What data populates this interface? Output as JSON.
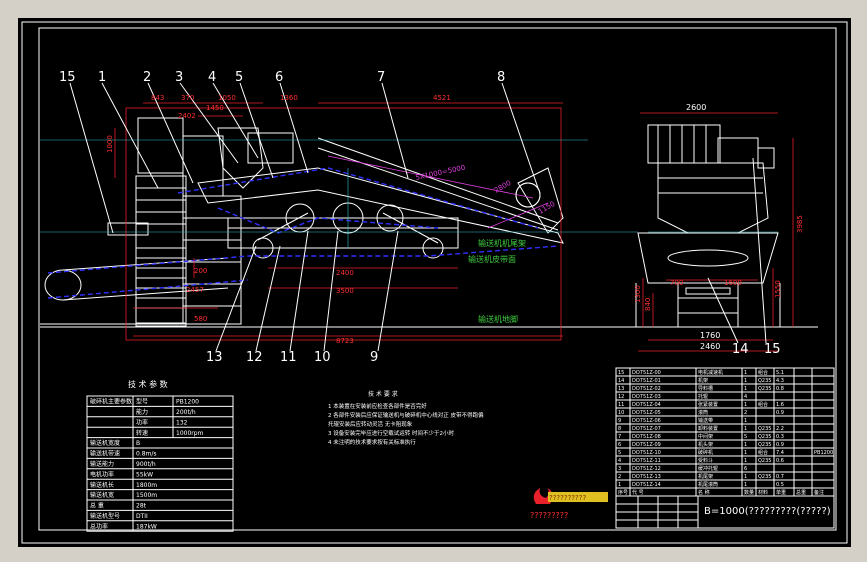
{
  "front_view": {
    "callouts": [
      "15",
      "1",
      "2",
      "3",
      "4",
      "5",
      "6",
      "7",
      "8",
      "13",
      "12",
      "11",
      "10",
      "9"
    ],
    "dimensions": {
      "d843": "843",
      "d370": "370",
      "d2402": "2402",
      "d1450": "1450",
      "d1050": "1050",
      "d1360": "1360",
      "d4521": "4521",
      "d1000": "1000",
      "d5x1000": "5X1000=5000",
      "d2800": "2800",
      "d1150": "1150",
      "d2400": "2400",
      "d3500": "3500",
      "d2457": "2457",
      "d200": "200",
      "d8723": "8723",
      "d580": "580"
    },
    "labels": {
      "tail_frame": "输送机机尾架",
      "belt_face": "输送机皮带面",
      "foundation": "输送机地脚"
    }
  },
  "side_view": {
    "callouts": [
      "14",
      "15"
    ],
    "dimensions": {
      "width": "2600",
      "right_h1": "3985",
      "right_h2": "1550",
      "left_h": "1300",
      "left_h2": "840",
      "d700": "700",
      "d1600": "1600",
      "bottom1": "1760",
      "bottom2": "2460"
    }
  },
  "tech_params": {
    "title": "技 术 参 数",
    "rows": [
      [
        "破碎机主要参数",
        "型号",
        "PB1200"
      ],
      [
        "",
        "能力",
        "200t/h"
      ],
      [
        "",
        "功率",
        "132"
      ],
      [
        "",
        "转速",
        "1000rpm"
      ],
      [
        "输送机宽度",
        "B",
        ""
      ],
      [
        "输送机带速",
        "0.8m/s",
        ""
      ],
      [
        "输送能力",
        "900t/h",
        ""
      ],
      [
        "电机功率",
        "55kW",
        ""
      ],
      [
        "输送机长",
        "1800m",
        ""
      ],
      [
        "输送机宽",
        "1500m",
        ""
      ],
      [
        "总 重",
        "28t",
        ""
      ],
      [
        "输送机型号",
        "DTII",
        ""
      ],
      [
        "总功率",
        "187kW",
        ""
      ]
    ]
  },
  "notes": {
    "title": "技 术 要 求",
    "lines": [
      "1 本装置在安装前应检查各部件是否完好",
      "2 各部件安装后应保证输送机与破碎机中心线对正 皮带不得跑偏",
      "  托辊安装后应转动灵活 无卡阻现象",
      "3 设备安装完毕应进行空载试运转 时间不少于2小时",
      "4 未注明的技术要求按有关标准执行"
    ]
  },
  "parts_list": {
    "headers": [
      "序号",
      "代 号",
      "名 称",
      "数量",
      "材料",
      "单重",
      "总重",
      "备注"
    ],
    "rows": [
      [
        "15",
        "DO751Z-00",
        "电机减速机",
        "1",
        "组合",
        "5.1",
        "",
        ""
      ],
      [
        "14",
        "DO751Z-01",
        "机架",
        "1",
        "Q235",
        "4.3",
        "",
        ""
      ],
      [
        "13",
        "DO751Z-02",
        "导料槽",
        "1",
        "Q235",
        "0.8",
        "",
        ""
      ],
      [
        "12",
        "DO751Z-03",
        "托辊",
        "4",
        "",
        "",
        "",
        ""
      ],
      [
        "11",
        "DO751Z-04",
        "张紧装置",
        "1",
        "组合",
        "1.6",
        "",
        ""
      ],
      [
        "10",
        "DO751Z-05",
        "滚筒",
        "2",
        "",
        "0.9",
        "",
        ""
      ],
      [
        "9",
        "DO751Z-06",
        "输送带",
        "1",
        "",
        "",
        "",
        ""
      ],
      [
        "8",
        "DO751Z-07",
        "卸料装置",
        "1",
        "Q235",
        "2.2",
        "",
        ""
      ],
      [
        "7",
        "DO751Z-08",
        "中间架",
        "5",
        "Q235",
        "0.3",
        "",
        ""
      ],
      [
        "6",
        "DO751Z-09",
        "机头架",
        "1",
        "Q235",
        "0.9",
        "",
        ""
      ],
      [
        "5",
        "DO751Z-10",
        "破碎机",
        "1",
        "组合",
        "7.4",
        "",
        "PB1200"
      ],
      [
        "4",
        "DO751Z-11",
        "受料斗",
        "1",
        "Q235",
        "0.6",
        "",
        ""
      ],
      [
        "3",
        "DO751Z-12",
        "缓冲托辊",
        "6",
        "",
        "",
        "",
        ""
      ],
      [
        "2",
        "DO751Z-13",
        "机尾架",
        "1",
        "Q235",
        "0.7",
        "",
        ""
      ],
      [
        "1",
        "DO751Z-14",
        "机尾滚筒",
        "1",
        "",
        "0.5",
        "",
        ""
      ]
    ]
  },
  "title_block": {
    "caption": "B=1000(?????????(?????)",
    "company": "?????????",
    "logo_text": "??????????"
  },
  "colors": {
    "background": "#000000",
    "outline": "#ffffff",
    "dimension": "#e8202a",
    "belt": "#3030ff",
    "label_green": "#40d040",
    "window": "#d4d0c8"
  }
}
